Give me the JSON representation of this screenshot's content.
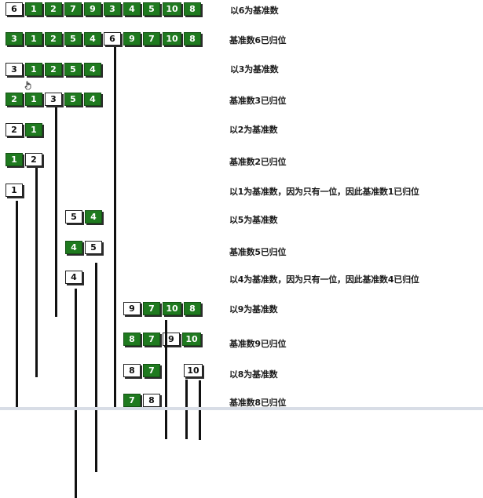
{
  "rows": [
    {
      "cells": [
        {
          "v": "6",
          "c": "white"
        },
        {
          "v": "1",
          "c": "green"
        },
        {
          "v": "2",
          "c": "green"
        },
        {
          "v": "7",
          "c": "green"
        },
        {
          "v": "9",
          "c": "green"
        },
        {
          "v": "3",
          "c": "green"
        },
        {
          "v": "4",
          "c": "green"
        },
        {
          "v": "5",
          "c": "green"
        },
        {
          "v": "10",
          "c": "green"
        },
        {
          "v": "8",
          "c": "green"
        }
      ]
    },
    {
      "cells": [
        {
          "v": "3",
          "c": "green"
        },
        {
          "v": "1",
          "c": "green"
        },
        {
          "v": "2",
          "c": "green"
        },
        {
          "v": "5",
          "c": "green"
        },
        {
          "v": "4",
          "c": "green"
        },
        {
          "v": "6",
          "c": "white"
        },
        {
          "v": "9",
          "c": "green"
        },
        {
          "v": "7",
          "c": "green"
        },
        {
          "v": "10",
          "c": "green"
        },
        {
          "v": "8",
          "c": "green"
        }
      ]
    },
    {
      "cells": [
        {
          "v": "3",
          "c": "white"
        },
        {
          "v": "1",
          "c": "green"
        },
        {
          "v": "2",
          "c": "green"
        },
        {
          "v": "5",
          "c": "green"
        },
        {
          "v": "4",
          "c": "green"
        }
      ]
    },
    {
      "cells": [
        {
          "v": "2",
          "c": "green"
        },
        {
          "v": "1",
          "c": "green"
        },
        {
          "v": "3",
          "c": "white"
        },
        {
          "v": "5",
          "c": "green"
        },
        {
          "v": "4",
          "c": "green"
        }
      ]
    },
    {
      "cells": [
        {
          "v": "2",
          "c": "white"
        },
        {
          "v": "1",
          "c": "green"
        }
      ]
    },
    {
      "cells": [
        {
          "v": "1",
          "c": "green"
        },
        {
          "v": "2",
          "c": "white"
        }
      ]
    },
    {
      "cells": [
        {
          "v": "1",
          "c": "white"
        }
      ]
    },
    {
      "cells": [
        {
          "v": "5",
          "c": "white"
        },
        {
          "v": "4",
          "c": "green"
        }
      ]
    },
    {
      "cells": [
        {
          "v": "4",
          "c": "green"
        },
        {
          "v": "5",
          "c": "white"
        }
      ]
    },
    {
      "cells": [
        {
          "v": "4",
          "c": "white"
        }
      ]
    },
    {
      "cells": [
        {
          "v": "9",
          "c": "white"
        },
        {
          "v": "7",
          "c": "green"
        },
        {
          "v": "10",
          "c": "green"
        },
        {
          "v": "8",
          "c": "green"
        }
      ]
    },
    {
      "cells": [
        {
          "v": "8",
          "c": "green"
        },
        {
          "v": "7",
          "c": "green"
        },
        {
          "v": "9",
          "c": "white"
        },
        {
          "v": "10",
          "c": "green"
        }
      ]
    },
    {
      "cells": [
        {
          "v": "8",
          "c": "white"
        },
        {
          "v": "7",
          "c": "green"
        }
      ]
    },
    {
      "cells": [
        {
          "v": "10",
          "c": "white"
        }
      ]
    },
    {
      "cells": [
        {
          "v": "7",
          "c": "green"
        },
        {
          "v": "8",
          "c": "white"
        }
      ]
    }
  ],
  "captions": [
    "以6为基准数",
    "基准数6已归位",
    "以3为基准数",
    "基准数3已归位",
    "以2为基准数",
    "基准数2已归位",
    "以1为基准数，因为只有一位，因此基准数1已归位",
    "以5为基准数",
    "基准数5已归位",
    "以4为基准数，因为只有一位，因此基准数4已归位",
    "以9为基准数",
    "基准数9已归位",
    "以8为基准数",
    "基准数8已归位"
  ],
  "colors": {
    "green": "#1f7a1f",
    "white": "#ffffff",
    "line": "#111111"
  },
  "icons": {
    "cursor": "hand-cursor-icon"
  }
}
